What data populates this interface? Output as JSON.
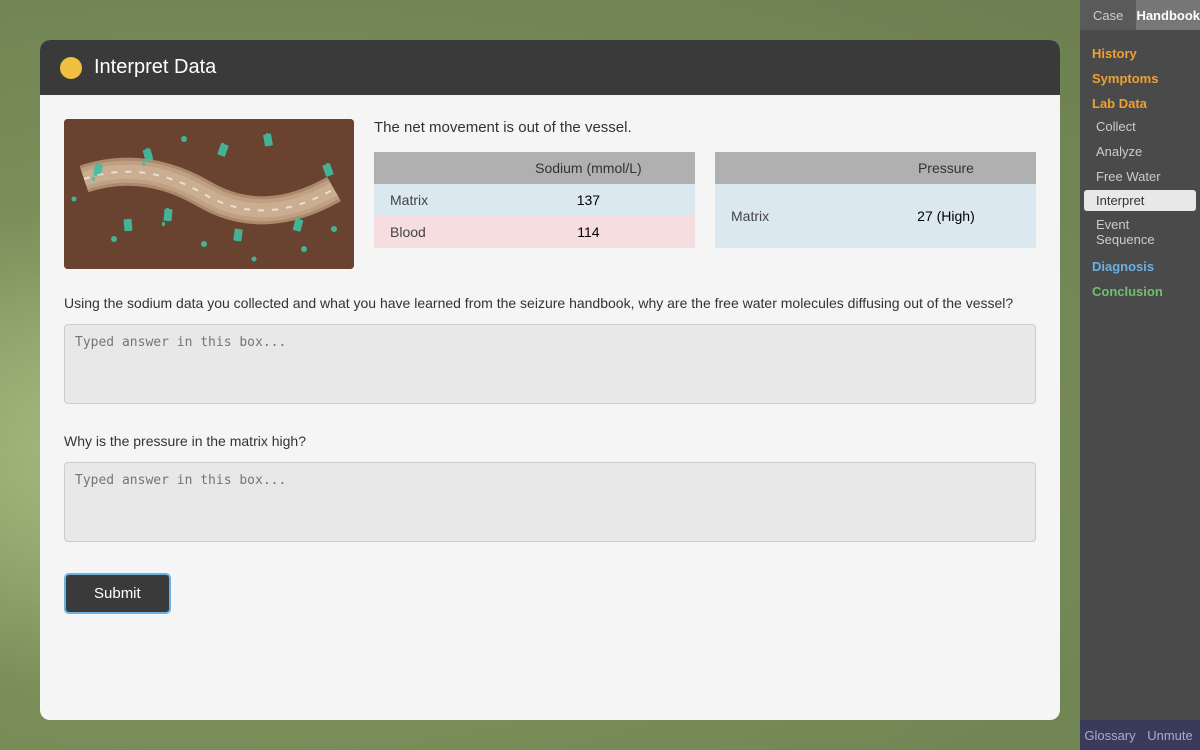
{
  "topNav": {
    "caseLabel": "Case",
    "handbookLabel": "Handbook"
  },
  "sidebar": {
    "sections": [
      {
        "label": "History",
        "color": "orange",
        "items": []
      },
      {
        "label": "Symptoms",
        "color": "orange",
        "items": []
      },
      {
        "label": "Lab Data",
        "color": "orange",
        "items": [
          {
            "label": "Collect",
            "active": false
          },
          {
            "label": "Analyze",
            "active": false
          },
          {
            "label": "Free Water",
            "active": false
          },
          {
            "label": "Interpret",
            "active": true
          },
          {
            "label": "Event Sequence",
            "active": false
          }
        ]
      },
      {
        "label": "Diagnosis",
        "color": "blue",
        "items": []
      },
      {
        "label": "Conclusion",
        "color": "green",
        "items": []
      }
    ]
  },
  "bottomBar": {
    "glossaryLabel": "Glossary",
    "unmuteLabel": "Unmute"
  },
  "card": {
    "title": "Interpret Data",
    "headerIconColor": "#f0c040"
  },
  "content": {
    "netMovementText": "The net movement is out of the vessel.",
    "sodiumTable": {
      "header": "Sodium (mmol/L)",
      "rows": [
        {
          "label": "Matrix",
          "value": "137"
        },
        {
          "label": "Blood",
          "value": "114"
        }
      ]
    },
    "pressureTable": {
      "header": "Pressure",
      "rows": [
        {
          "label": "Matrix",
          "value": "27 (High)"
        }
      ]
    },
    "question1": "Using the sodium data you collected and what you have learned from the seizure handbook, why are the free water molecules diffusing out of the vessel?",
    "answer1Placeholder": "Typed answer in this box...",
    "question2": "Why is the pressure in the matrix high?",
    "answer2Placeholder": "Typed answer in this box...",
    "submitLabel": "Submit"
  }
}
